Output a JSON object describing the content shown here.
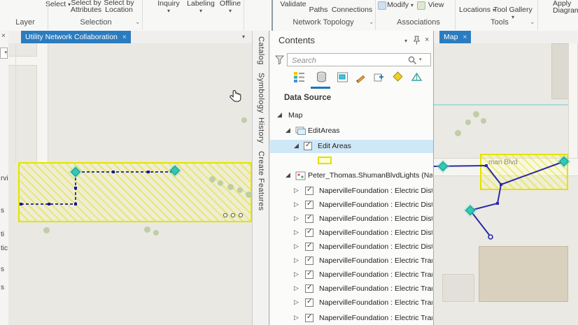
{
  "glyphs": {
    "caret_down": "▾",
    "close": "×",
    "expanded_arrow": "◢",
    "collapsed_arrow": "▷",
    "check": "✓",
    "launcher": "⌄"
  },
  "ribbon": {
    "buttons": {
      "select": "Select",
      "select_by_attributes": "Select by\nAttributes",
      "select_by_location": "Select by\nLocation",
      "inquiry": "Inquiry",
      "labeling": "Labeling",
      "offline": "Offline",
      "validate": "Validate",
      "paths": "Paths",
      "connections": "Connections",
      "modify": "Modify",
      "view": "View",
      "locations": "Locations",
      "tool_gallery": "Tool Gallery",
      "apply": "Apply",
      "diagram": "Diagram"
    },
    "groups": {
      "layer": "Layer",
      "selection": "Selection",
      "network_topology": "Network Topology",
      "associations": "Associations",
      "tools": "Tools"
    }
  },
  "left_pane_fragments": {
    "items": [
      "rvi",
      "s",
      "ti",
      "tic",
      "s",
      "s"
    ]
  },
  "left_view": {
    "tab_label": "Utility Network Collaboration"
  },
  "side_tabs": {
    "catalog": "Catalog",
    "symbology": "Symbology",
    "history": "History",
    "create_features": "Create Features"
  },
  "contents": {
    "title": "Contents",
    "search_placeholder": "Search",
    "section_label": "Data Source",
    "tree": {
      "map_label": "Map",
      "group_label": "EditAreas",
      "layer_label": "Edit Areas",
      "service_label": "Peter_Thomas.ShumanBlvdLights (Nap",
      "layers": [
        "NapervilleFoundation : Electric Distri",
        "NapervilleFoundation : Electric Distri",
        "NapervilleFoundation : Electric Distri",
        "NapervilleFoundation : Electric Distri",
        "NapervilleFoundation : Electric Distri",
        "NapervilleFoundation : Electric Transf",
        "NapervilleFoundation : Electric Transf",
        "NapervilleFoundation : Electric Transf",
        "NapervilleFoundation : Electric Transf",
        "NapervilleFoundation : Electric Trans"
      ]
    }
  },
  "right_view": {
    "tab_label": "Map",
    "road_label": "man Blvd"
  },
  "colors": {
    "accent_blue": "#2b7cbf",
    "selection_blue": "#cfe8f8",
    "edit_area_yellow": "#e3e300",
    "network_blue": "#2a2aa5",
    "marker_teal": "#2fc9b6"
  }
}
